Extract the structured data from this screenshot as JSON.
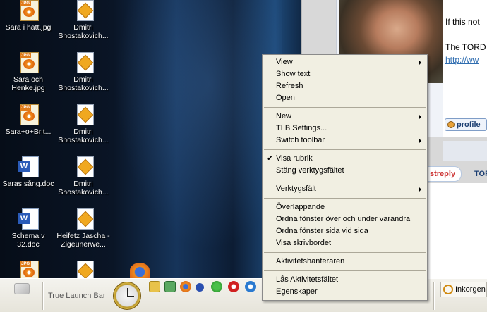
{
  "desktop": {
    "col1": [
      {
        "label": "Sara i hatt.jpg",
        "type": "jpg"
      },
      {
        "label": "Sara och Henke.jpg",
        "type": "jpg"
      },
      {
        "label": "Sara+o+Brit...",
        "type": "jpg"
      },
      {
        "label": "Saras sång.doc",
        "type": "doc"
      },
      {
        "label": "Schema v 32.doc",
        "type": "doc"
      },
      {
        "label": "",
        "type": "jpg"
      }
    ],
    "col2": [
      {
        "label": "Dmitri Shostakovich...",
        "type": "mp3"
      },
      {
        "label": "Dmitri Shostakovich...",
        "type": "mp3"
      },
      {
        "label": "Dmitri Shostakovich...",
        "type": "mp3"
      },
      {
        "label": "Dmitri Shostakovich...",
        "type": "mp3"
      },
      {
        "label": "Heifetz Jascha - Zigeunerwe...",
        "type": "mp3"
      },
      {
        "label": "",
        "type": "mp3"
      }
    ],
    "jpg_tag": "JPG"
  },
  "browser": {
    "post_line1": "If this not",
    "post_line2": "The TORD",
    "post_link": "http://ww",
    "profile_button": "profile",
    "reply_button": "streply",
    "tor_label": "TOR"
  },
  "context_menu": {
    "groups": [
      [
        {
          "label": "View",
          "submenu": true
        },
        {
          "label": "Show text"
        },
        {
          "label": "Refresh"
        },
        {
          "label": "Open"
        }
      ],
      [
        {
          "label": "New",
          "submenu": true
        },
        {
          "label": "TLB Settings..."
        },
        {
          "label": "Switch toolbar",
          "submenu": true
        }
      ],
      [
        {
          "label": "Visa rubrik",
          "checked": true
        },
        {
          "label": "Stäng verktygsfältet"
        }
      ],
      [
        {
          "label": "Verktygsfält",
          "submenu": true
        }
      ],
      [
        {
          "label": "Överlappande"
        },
        {
          "label": "Ordna fönster över och under varandra"
        },
        {
          "label": "Ordna fönster sida vid sida"
        },
        {
          "label": "Visa skrivbordet"
        }
      ],
      [
        {
          "label": "Aktivitetshanteraren"
        }
      ],
      [
        {
          "label": "Lås Aktivitetsfältet"
        },
        {
          "label": "Egenskaper"
        }
      ]
    ]
  },
  "taskbar": {
    "launch_bar_label": "True Launch Bar",
    "quick_launch_icons": [
      "folder-icon",
      "music-icon",
      "firefox-icon",
      "network-icon",
      "messenger-icon",
      "opera-icon",
      "quicktime-icon"
    ],
    "inbox_button": "Inkorgen"
  },
  "check_glyph": "✔"
}
